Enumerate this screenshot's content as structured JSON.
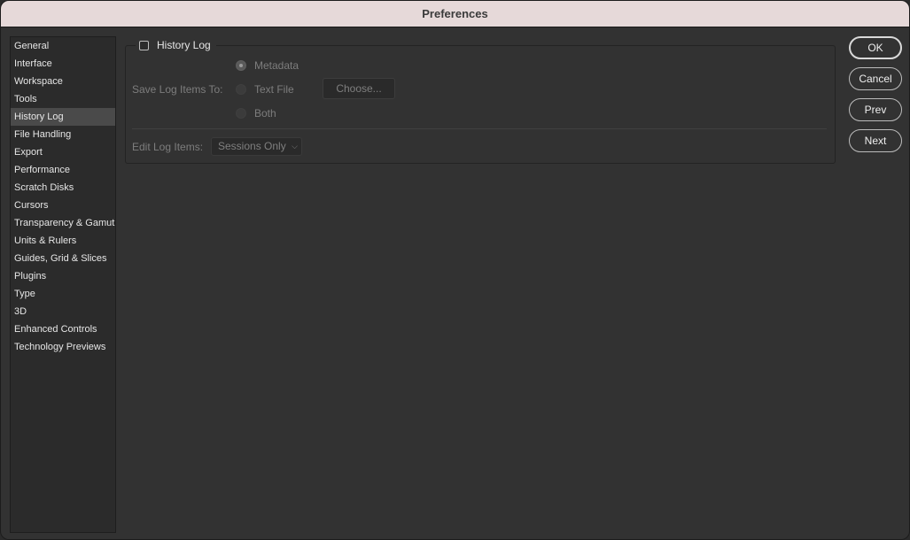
{
  "window": {
    "title": "Preferences"
  },
  "sidebar": {
    "items": [
      {
        "label": "General"
      },
      {
        "label": "Interface"
      },
      {
        "label": "Workspace"
      },
      {
        "label": "Tools"
      },
      {
        "label": "History Log",
        "active": true
      },
      {
        "label": "File Handling"
      },
      {
        "label": "Export"
      },
      {
        "label": "Performance"
      },
      {
        "label": "Scratch Disks"
      },
      {
        "label": "Cursors"
      },
      {
        "label": "Transparency & Gamut"
      },
      {
        "label": "Units & Rulers"
      },
      {
        "label": "Guides, Grid & Slices"
      },
      {
        "label": "Plugins"
      },
      {
        "label": "Type"
      },
      {
        "label": "3D"
      },
      {
        "label": "Enhanced Controls"
      },
      {
        "label": "Technology Previews"
      }
    ]
  },
  "history_log": {
    "title": "History Log",
    "enabled": false,
    "save_label": "Save Log Items To:",
    "options": {
      "metadata": "Metadata",
      "text_file": "Text File",
      "both": "Both"
    },
    "selected": "Metadata",
    "choose_label": "Choose...",
    "edit_label": "Edit Log Items:",
    "edit_value": "Sessions Only"
  },
  "buttons": {
    "ok": "OK",
    "cancel": "Cancel",
    "prev": "Prev",
    "next": "Next"
  },
  "icons": {
    "checkbox": "checkbox-icon",
    "dropdown": "chevron-down-icon"
  }
}
